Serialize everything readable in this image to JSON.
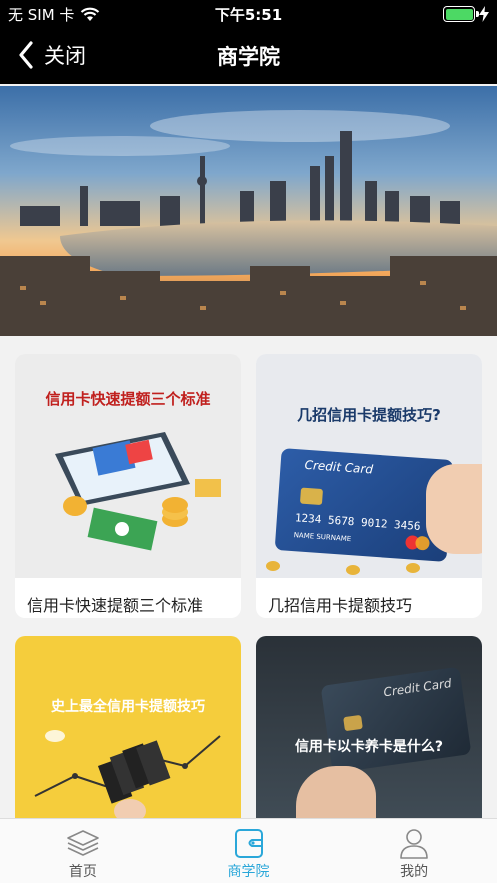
{
  "status_bar": {
    "carrier": "无 SIM 卡",
    "time": "下午5:51",
    "battery_level": 1.0
  },
  "nav": {
    "back_label": "关闭",
    "title": "商学院"
  },
  "cards": [
    {
      "title": "信用卡快速提额三个标准",
      "banner": "信用卡快速提额三个标准"
    },
    {
      "title": "几招信用卡提额技巧",
      "banner": "几招信用卡提额技巧?",
      "card_brand": "Credit Card",
      "card_number": "1234 5678 9012 3456",
      "card_name": "NAME SURNAME"
    },
    {
      "title": "",
      "banner": "史上最全信用卡提额技巧"
    },
    {
      "title": "",
      "banner": "信用卡以卡养卡是什么?",
      "card_brand": "Credit Card"
    }
  ],
  "tabs": [
    {
      "label": "首页",
      "icon": "layers-icon",
      "active": false
    },
    {
      "label": "商学院",
      "icon": "wallet-icon",
      "active": true
    },
    {
      "label": "我的",
      "icon": "user-icon",
      "active": false
    }
  ],
  "colors": {
    "accent": "#2aa7d9",
    "bar_bg": "#000000",
    "battery": "#4cd964"
  }
}
